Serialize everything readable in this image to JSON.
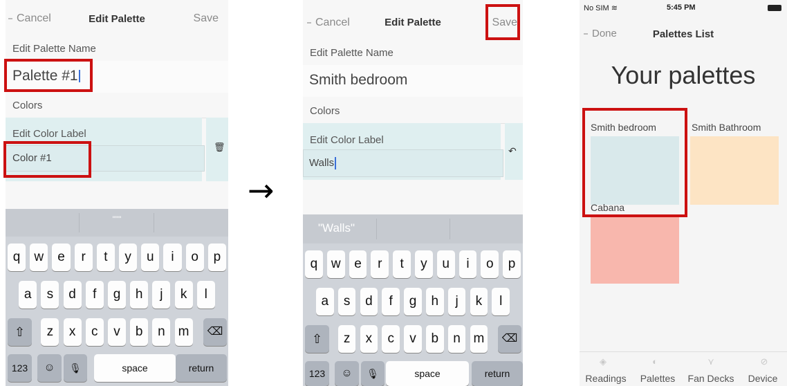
{
  "screen1": {
    "nav": {
      "cancel": "Cancel",
      "title": "Edit Palette",
      "save": "Save"
    },
    "name_label": "Edit Palette Name",
    "name_value": "Palette #1",
    "colors_label": "Colors",
    "color_label_title": "Edit Color Label",
    "color_value": "Color #1",
    "prediction": "\"\"\"",
    "keys": {
      "row1": [
        "q",
        "w",
        "e",
        "r",
        "t",
        "y",
        "u",
        "i",
        "o",
        "p"
      ],
      "row2": [
        "a",
        "s",
        "d",
        "f",
        "g",
        "h",
        "j",
        "k",
        "l"
      ],
      "row3": [
        "z",
        "x",
        "c",
        "v",
        "b",
        "n",
        "m"
      ],
      "num": "123",
      "space": "space",
      "return": "return"
    }
  },
  "transition_arrow": "→",
  "screen2": {
    "nav": {
      "cancel": "Cancel",
      "title": "Edit Palette",
      "save": "Save"
    },
    "name_label": "Edit Palette Name",
    "name_value": "Smith bedroom",
    "colors_label": "Colors",
    "color_label_title": "Edit Color Label",
    "color_value": "Walls",
    "prediction": "\"Walls\"",
    "keys": {
      "row1": [
        "q",
        "w",
        "e",
        "r",
        "t",
        "y",
        "u",
        "i",
        "o",
        "p"
      ],
      "row2": [
        "a",
        "s",
        "d",
        "f",
        "g",
        "h",
        "j",
        "k",
        "l"
      ],
      "row3": [
        "z",
        "x",
        "c",
        "v",
        "b",
        "n",
        "m"
      ],
      "num": "123",
      "space": "space",
      "return": "return"
    }
  },
  "screen3": {
    "status": {
      "carrier": "No SIM",
      "time": "5:45 PM"
    },
    "nav": {
      "done": "Done",
      "title": "Palettes List"
    },
    "heading": "Your palettes",
    "palettes": [
      {
        "name": "Smith bedroom",
        "color": "#d9e9eb"
      },
      {
        "name": "Smith Bathroom",
        "color": "#fde4c4"
      },
      {
        "name": "Cabana",
        "color": "#f8b7ad"
      }
    ],
    "tabs": [
      "Readings",
      "Palettes",
      "Fan Decks",
      "Device"
    ]
  },
  "colors": {
    "highlight": "#cc1111",
    "field": "#dcecee",
    "cursor": "#3a6fd8"
  }
}
